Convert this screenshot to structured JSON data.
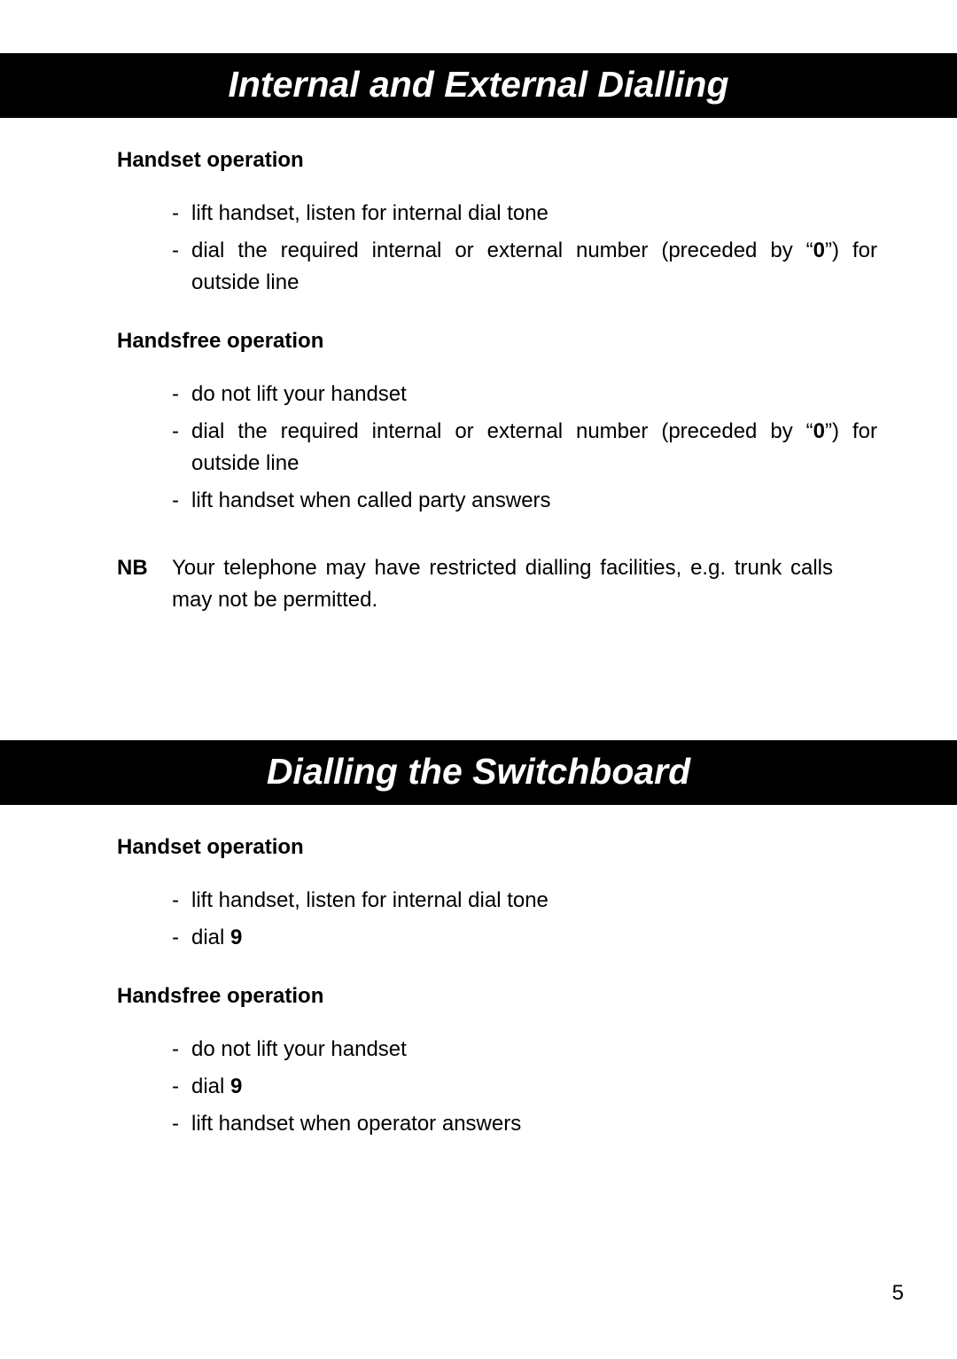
{
  "page_number": "5",
  "sections": [
    {
      "title": "Internal and External Dialling",
      "blocks": [
        {
          "heading": "Handset operation",
          "items": [
            "lift handset, listen for internal dial tone",
            "dial the required internal or external number (preceded by “0”) for outside line"
          ]
        },
        {
          "heading": "Handsfree operation",
          "items": [
            "do not lift your handset",
            "dial the required internal or external number (preceded by “0”) for outside line",
            "lift handset when called party answers"
          ]
        }
      ],
      "nb_label": "NB",
      "nb_text": "Your telephone may have restricted dialling facilities, e.g. trunk calls may not be permitted."
    },
    {
      "title": "Dialling the Switchboard",
      "blocks": [
        {
          "heading": "Handset operation",
          "items": [
            "lift handset, listen for internal dial tone",
            "dial 9"
          ]
        },
        {
          "heading": "Handsfree operation",
          "items": [
            "do not lift your handset",
            "dial 9",
            "lift handset when operator answers"
          ]
        }
      ]
    }
  ],
  "bold_zero": "0",
  "bold_nine": "9"
}
